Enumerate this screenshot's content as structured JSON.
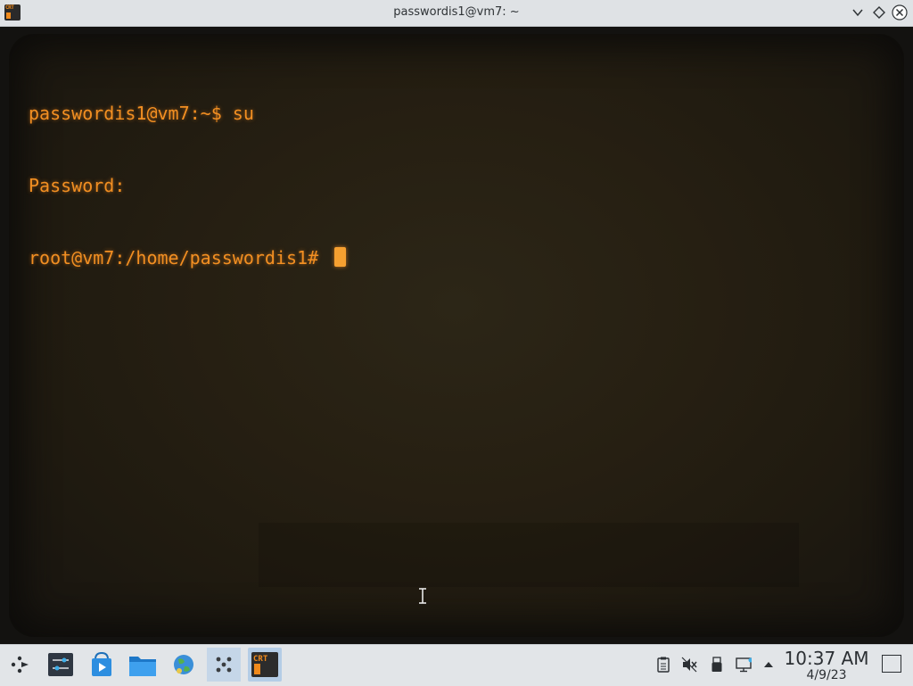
{
  "window": {
    "title": "passwordis1@vm7: ~",
    "app_icon": "crt-icon"
  },
  "terminal": {
    "lines": [
      "passwordis1@vm7:~$ su",
      "Password:",
      "root@vm7:/home/passwordis1# "
    ],
    "text_color": "#f28f22",
    "background_color": "#261f12"
  },
  "taskbar": {
    "launcher_icon": "application-launcher-icon",
    "pinned": [
      {
        "name": "system-settings",
        "icon": "sliders-icon"
      },
      {
        "name": "discover",
        "icon": "shopping-bag-icon"
      },
      {
        "name": "file-manager",
        "icon": "folder-icon"
      },
      {
        "name": "web-browser",
        "icon": "globe-icon"
      },
      {
        "name": "games",
        "icon": "dice-icon"
      },
      {
        "name": "cool-retro-term",
        "icon": "crt-icon"
      }
    ],
    "tray": [
      "clipboard-icon",
      "volume-muted-icon",
      "usb-drive-icon",
      "network-icon",
      "expand-tray-icon"
    ],
    "clock": {
      "time": "10:37 AM",
      "date": "4/9/23"
    }
  },
  "crt_icon_text": "CRT"
}
